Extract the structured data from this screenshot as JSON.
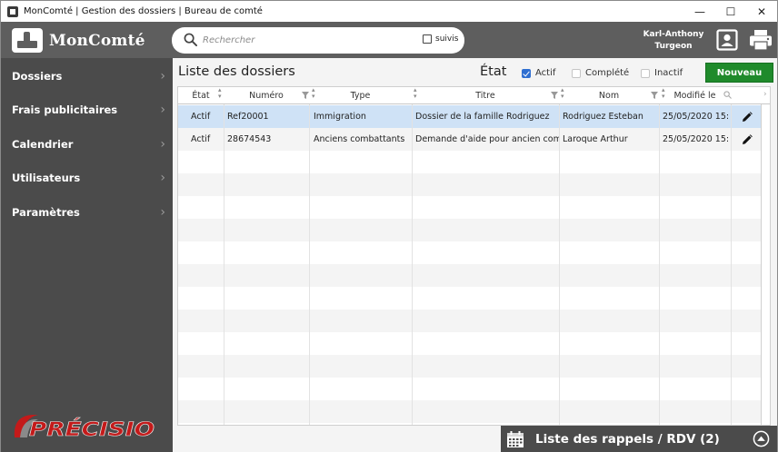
{
  "window": {
    "title": "MonComté | Gestion des dossiers | Bureau de comté",
    "controls": [
      "—",
      "☐",
      "✕"
    ]
  },
  "header": {
    "logo_text": "MonComté",
    "search": {
      "placeholder": "Rechercher",
      "value": ""
    },
    "suivis_label": "suivis",
    "user_first": "Karl-Anthony",
    "user_last": "Turgeon",
    "icons": [
      "contact-card-icon",
      "printer-icon"
    ]
  },
  "sidebar": {
    "items": [
      {
        "label": "Dossiers"
      },
      {
        "label": "Frais publicitaires"
      },
      {
        "label": "Calendrier"
      },
      {
        "label": "Utilisateurs"
      },
      {
        "label": "Paramètres"
      }
    ],
    "chevron": "›",
    "brand_text": "PRÉCISIO",
    "brand_color": "#c41a1a"
  },
  "main": {
    "title": "Liste des dossiers",
    "etat_label": "État",
    "filters": [
      {
        "label": "Actif",
        "checked": true
      },
      {
        "label": "Complété",
        "checked": false
      },
      {
        "label": "Inactif",
        "checked": false
      }
    ],
    "new_button": "Nouveau",
    "columns": [
      "État",
      "Numéro",
      "Type",
      "Titre",
      "Nom",
      "Modifié le"
    ],
    "rows": [
      {
        "etat": "Actif",
        "numero": "Ref20001",
        "type": "Immigration",
        "titre": "Dossier de la famille Rodriguez",
        "nom": "Rodriguez Esteban",
        "modifie": "25/05/2020 15:"
      },
      {
        "etat": "Actif",
        "numero": "28674543",
        "type": "Anciens combattants",
        "titre": "Demande d'aide pour ancien comb",
        "nom": "Laroque Arthur",
        "modifie": "25/05/2020 15:"
      }
    ],
    "rdv_label": "Liste des rappels / RDV (2)",
    "colors": {
      "accent": "#1f8a2b",
      "selected_row": "#cfe2f6",
      "dark": "#4b4b4b",
      "header": "#5e5e5e",
      "checkbox": "#2f6fd1"
    }
  }
}
